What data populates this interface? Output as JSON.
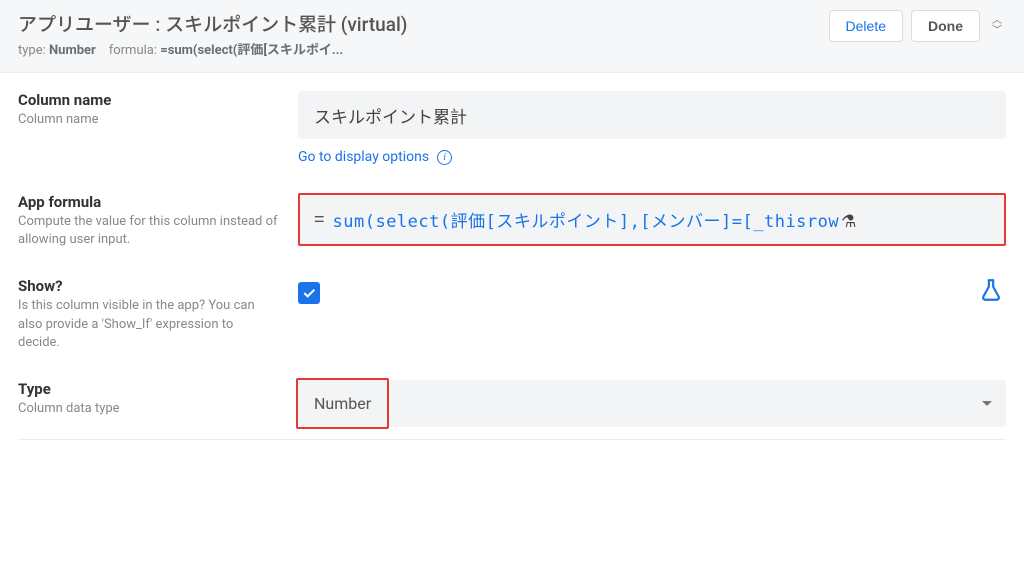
{
  "header": {
    "title": "アプリユーザー : スキルポイント累計 (virtual)",
    "type_label": "type:",
    "type_value": "Number",
    "formula_label": "formula:",
    "formula_value": "=sum(select(評価[スキルポイ...",
    "actions": {
      "delete": "Delete",
      "done": "Done"
    }
  },
  "fields": {
    "column_name": {
      "label": "Column name",
      "desc": "Column name",
      "value": "スキルポイント累計",
      "link": "Go to display options"
    },
    "app_formula": {
      "label": "App formula",
      "desc": "Compute the value for this column instead of allowing user input.",
      "eq": "=",
      "code": "sum(select(評価[スキルポイント],[メンバー]=[_thisrow"
    },
    "show": {
      "label": "Show?",
      "desc": "Is this column visible in the app? You can also provide a 'Show_If' expression to decide.",
      "checked": true
    },
    "type": {
      "label": "Type",
      "desc": "Column data type",
      "value": "Number"
    }
  }
}
